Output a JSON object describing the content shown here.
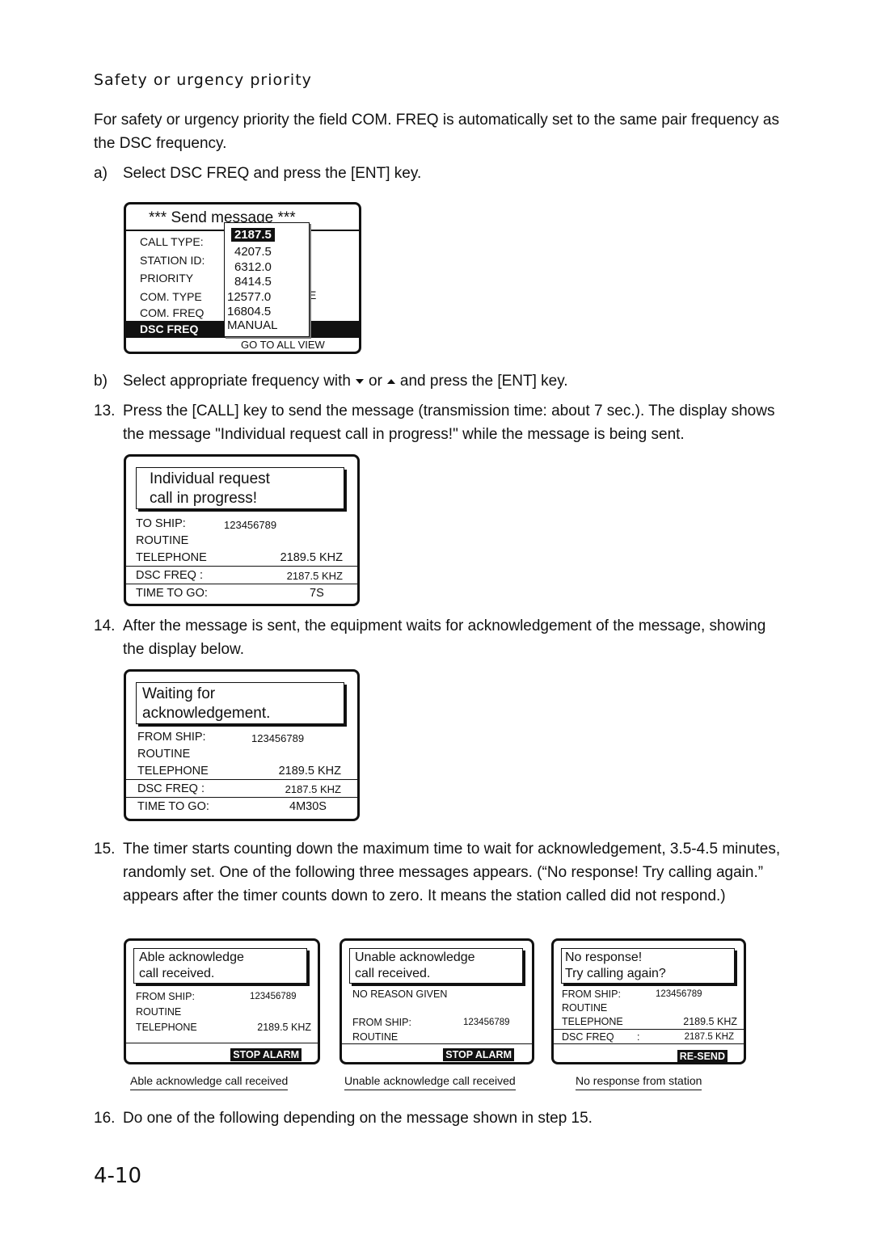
{
  "section_title": "Safety or urgency priority",
  "intro": "For safety or urgency priority the field COM. FREQ is automatically set to the same pair frequency as the DSC frequency.",
  "step_a": {
    "label": "a)",
    "text": "Select DSC FREQ and press the [ENT] key."
  },
  "screen1": {
    "title": "*** Send message ***",
    "rows": [
      "CALL TYPE:",
      "STATION ID:",
      "PRIORITY",
      "COM. TYPE",
      "COM. FREQ"
    ],
    "highlight": "DSC FREQ",
    "com_type_tail": "E",
    "footer": "GO TO ALL VIEW",
    "dropdown": {
      "selected": "2187.5",
      "options": [
        "4207.5",
        "6312.0",
        "8414.5",
        "12577.0",
        "16804.5",
        "MANUAL"
      ]
    }
  },
  "step_b": {
    "label": "b)",
    "pre": "Select appropriate frequency with",
    "or": "or",
    "post": "and press the [ENT] key."
  },
  "step13": {
    "num": "13.",
    "text": "Press the [CALL] key to send the message (transmission time: about 7 sec.). The display shows the message \"Individual request call in progress!\" while the message is being sent."
  },
  "screen2": {
    "msg1": "Individual request",
    "msg2": "call in progress!",
    "to_ship": "TO SHIP:",
    "id": "123456789",
    "priority": "ROUTINE",
    "type": "TELEPHONE",
    "freq": "2189.5 KHZ",
    "dsc_label": "DSC FREQ  :",
    "dsc_val": "2187.5 KHZ",
    "time_label": "TIME TO GO:",
    "time_val": "7S"
  },
  "step14": {
    "num": "14.",
    "text": "After the message is sent, the equipment waits for acknowledgement of the message, showing the display below."
  },
  "screen3": {
    "msg1": "Waiting for",
    "msg2": "acknowledgement.",
    "from_ship": "FROM SHIP:",
    "id": "123456789",
    "priority": "ROUTINE",
    "type": "TELEPHONE",
    "freq": "2189.5 KHZ",
    "dsc_label": "DSC FREQ  :",
    "dsc_val": "2187.5 KHZ",
    "time_label": "TIME TO GO:",
    "time_val": "4M30S"
  },
  "step15": {
    "num": "15.",
    "text": "The timer starts counting down the maximum time to wait for acknowledgement, 3.5-4.5 minutes, randomly set. One of the following three messages appears. (“No response! Try calling again.” appears after the timer counts down to zero. It means the station called did not respond.)"
  },
  "screen_able": {
    "msg1": "Able acknowledge",
    "msg2": "call received.",
    "from_ship": "FROM SHIP:",
    "id": "123456789",
    "priority": "ROUTINE",
    "type": "TELEPHONE",
    "freq": "2189.5 KHZ",
    "button": "STOP ALARM",
    "caption": "Able acknowledge call received"
  },
  "screen_unable": {
    "msg1": "Unable acknowledge",
    "msg2": "call received.",
    "reason": "NO REASON GIVEN",
    "from_ship": "FROM SHIP:",
    "id": "123456789",
    "priority": "ROUTINE",
    "button": "STOP ALARM",
    "caption": "Unable acknowledge call received"
  },
  "screen_noresp": {
    "msg1": "No response!",
    "msg2": "Try calling again?",
    "from_ship": "FROM SHIP:",
    "id": "123456789",
    "priority": "ROUTINE",
    "type": "TELEPHONE",
    "freq": "2189.5 KHZ",
    "dsc_label": "DSC FREQ",
    "dsc_colon": ":",
    "dsc_val": "2187.5 KHZ",
    "button": "RE-SEND",
    "caption": "No response from station"
  },
  "step16": {
    "num": "16.",
    "text": "Do one of the following depending on the message shown in step 15."
  },
  "page_number": "4-10"
}
